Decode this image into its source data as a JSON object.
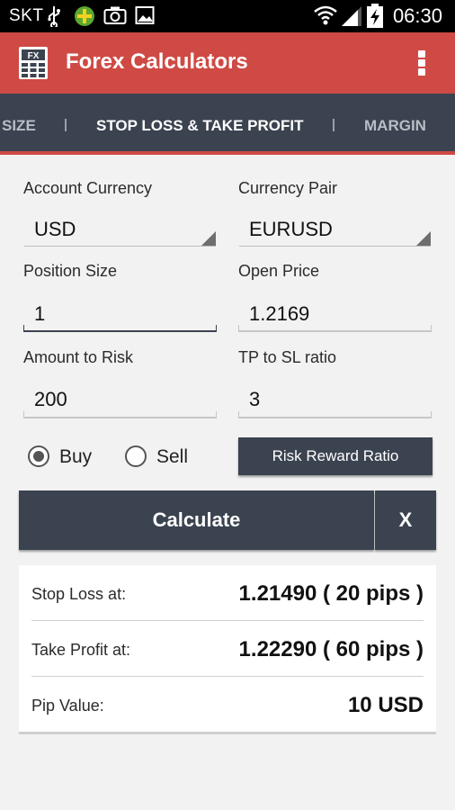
{
  "status_bar": {
    "carrier": "SKT",
    "time": "06:30",
    "icons": [
      "usb-icon",
      "app-notification-icon",
      "camera-icon",
      "image-icon",
      "wifi-icon",
      "signal-icon",
      "battery-charging-icon"
    ]
  },
  "app_bar": {
    "title": "Forex Calculators",
    "logo_text": "FX",
    "menu_icon": "overflow-menu-icon"
  },
  "tabs": {
    "items": [
      {
        "label": "SIZE"
      },
      {
        "label": "STOP LOSS & TAKE PROFIT"
      },
      {
        "label": "MARGIN"
      }
    ],
    "active": "STOP LOSS & TAKE PROFIT"
  },
  "form": {
    "account_currency": {
      "label": "Account Currency",
      "value": "USD"
    },
    "currency_pair": {
      "label": "Currency Pair",
      "value": "EURUSD"
    },
    "position_size": {
      "label": "Position Size",
      "value": "1"
    },
    "open_price": {
      "label": "Open Price",
      "value": "1.2169"
    },
    "amount_to_risk": {
      "label": "Amount to Risk",
      "value": "200"
    },
    "tp_sl_ratio": {
      "label": "TP to SL ratio",
      "value": "3"
    },
    "direction": {
      "options": [
        {
          "label": "Buy",
          "checked": true
        },
        {
          "label": "Sell",
          "checked": false
        }
      ]
    },
    "risk_reward_button": "Risk Reward Ratio"
  },
  "actions": {
    "calculate_label": "Calculate",
    "clear_label": "X"
  },
  "results": [
    {
      "label": "Stop Loss at:",
      "value": "1.21490 ( 20 pips )"
    },
    {
      "label": "Take Profit at:",
      "value": "1.22290 ( 60 pips )"
    },
    {
      "label": "Pip Value:",
      "value": "10 USD"
    }
  ],
  "colors": {
    "app_bar": "#cf4a44",
    "tab_bar": "#3b4350",
    "button": "#3b4350",
    "background": "#f2f2f2"
  }
}
